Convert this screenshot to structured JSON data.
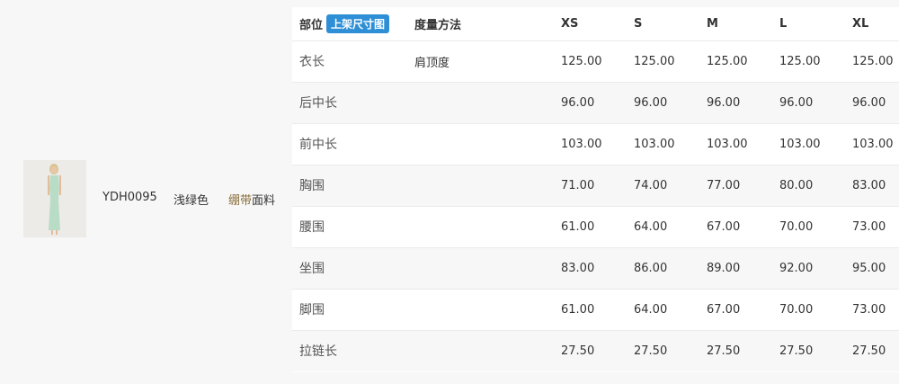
{
  "product": {
    "code": "YDH0095",
    "color": "浅绿色",
    "fabric_highlight": "绷带",
    "fabric_rest": "面料",
    "image_icon": "dress-photo-icon"
  },
  "table": {
    "headers": {
      "part": "部位",
      "badge": "上架尺寸图",
      "method": "度量方法",
      "sizes": [
        "XS",
        "S",
        "M",
        "L",
        "XL"
      ]
    },
    "rows": [
      {
        "part": "衣长",
        "method": "肩顶度",
        "values": [
          "125.00",
          "125.00",
          "125.00",
          "125.00",
          "125.00"
        ]
      },
      {
        "part": "后中长",
        "method": "",
        "values": [
          "96.00",
          "96.00",
          "96.00",
          "96.00",
          "96.00"
        ]
      },
      {
        "part": "前中长",
        "method": "",
        "values": [
          "103.00",
          "103.00",
          "103.00",
          "103.00",
          "103.00"
        ]
      },
      {
        "part": "胸围",
        "method": "",
        "values": [
          "71.00",
          "74.00",
          "77.00",
          "80.00",
          "83.00"
        ]
      },
      {
        "part": "腰围",
        "method": "",
        "values": [
          "61.00",
          "64.00",
          "67.00",
          "70.00",
          "73.00"
        ]
      },
      {
        "part": "坐围",
        "method": "",
        "values": [
          "83.00",
          "86.00",
          "89.00",
          "92.00",
          "95.00"
        ]
      },
      {
        "part": "脚围",
        "method": "",
        "values": [
          "61.00",
          "64.00",
          "67.00",
          "70.00",
          "73.00"
        ]
      },
      {
        "part": "拉链长",
        "method": "",
        "values": [
          "27.50",
          "27.50",
          "27.50",
          "27.50",
          "27.50"
        ]
      }
    ]
  },
  "colors": {
    "badge_bg": "#2e8fd6",
    "fabric_highlight": "#8a6d3b",
    "dress": "#b9dcc6"
  }
}
